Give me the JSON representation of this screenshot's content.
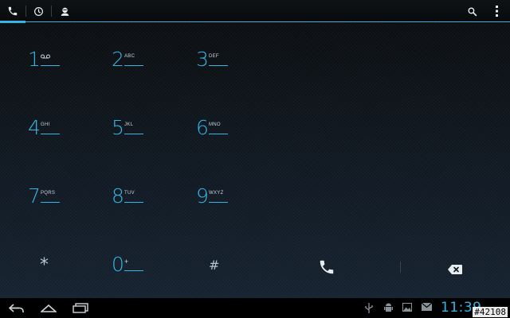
{
  "tabs": [
    {
      "name": "phone",
      "icon": "phone-icon",
      "active": true
    },
    {
      "name": "recent",
      "icon": "clock-icon",
      "active": false
    },
    {
      "name": "contacts",
      "icon": "contact-icon",
      "active": false
    }
  ],
  "actions": {
    "search_icon": "search-icon",
    "overflow_icon": "overflow-menu-icon"
  },
  "keypad": {
    "k1": {
      "digit": "1",
      "letters": ""
    },
    "k2": {
      "digit": "2",
      "letters": "ABC"
    },
    "k3": {
      "digit": "3",
      "letters": "DEF"
    },
    "k4": {
      "digit": "4",
      "letters": "GHI"
    },
    "k5": {
      "digit": "5",
      "letters": "JKL"
    },
    "k6": {
      "digit": "6",
      "letters": "MNO"
    },
    "k7": {
      "digit": "7",
      "letters": "PQRS"
    },
    "k8": {
      "digit": "8",
      "letters": "TUV"
    },
    "k9": {
      "digit": "9",
      "letters": "WXYZ"
    },
    "star": {
      "digit": "*"
    },
    "k0": {
      "digit": "0",
      "letters": "+"
    },
    "pound": {
      "digit": "#"
    }
  },
  "status": {
    "time": "11:39"
  },
  "watermark": "#42108",
  "colors": {
    "accent": "#33b5e5",
    "background": "#0a0d10"
  }
}
